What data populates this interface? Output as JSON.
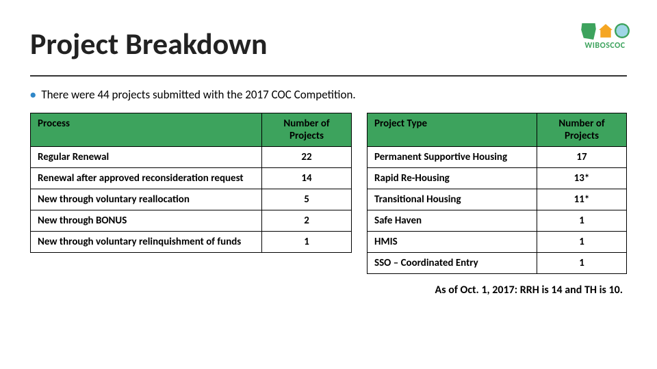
{
  "title": "Project Breakdown",
  "logo": {
    "text": "WIBOSCOC"
  },
  "bullet": "There were 44 projects submitted with the 2017 COC Competition.",
  "table_left": {
    "headers": {
      "c1": "Process",
      "c2": "Number of Projects"
    },
    "rows": [
      {
        "c1": "Regular Renewal",
        "c2": "22"
      },
      {
        "c1": "Renewal after approved reconsideration request",
        "c2": "14"
      },
      {
        "c1": "New through voluntary reallocation",
        "c2": "5"
      },
      {
        "c1": "New through BONUS",
        "c2": "2"
      },
      {
        "c1": "New through voluntary relinquishment of funds",
        "c2": "1"
      }
    ]
  },
  "table_right": {
    "headers": {
      "c1": "Project Type",
      "c2": "Number of Projects"
    },
    "rows": [
      {
        "c1": "Permanent Supportive Housing",
        "c2": "17"
      },
      {
        "c1": "Rapid Re-Housing",
        "c2": "13*"
      },
      {
        "c1": "Transitional Housing",
        "c2": "11*"
      },
      {
        "c1": "Safe Haven",
        "c2": "1"
      },
      {
        "c1": "HMIS",
        "c2": "1"
      },
      {
        "c1": "SSO – Coordinated Entry",
        "c2": "1"
      }
    ]
  },
  "footnote": "As of Oct. 1, 2017: RRH is 14 and TH is 10."
}
